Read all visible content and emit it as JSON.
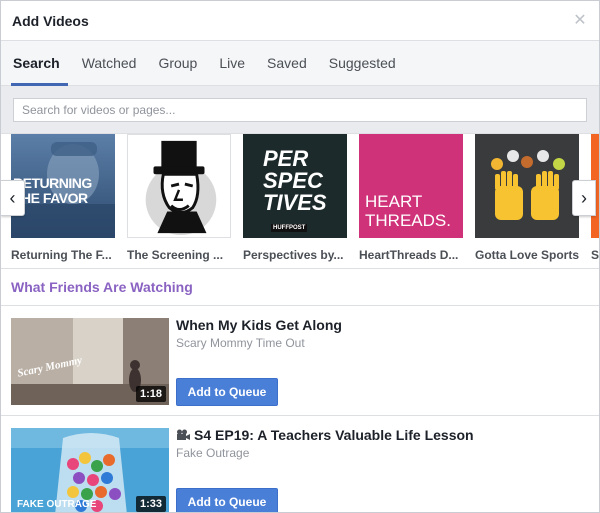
{
  "dialog": {
    "title": "Add Videos",
    "close_icon": "close-icon"
  },
  "tabs": [
    {
      "label": "Search",
      "active": true
    },
    {
      "label": "Watched",
      "active": false
    },
    {
      "label": "Group",
      "active": false
    },
    {
      "label": "Live",
      "active": false
    },
    {
      "label": "Saved",
      "active": false
    },
    {
      "label": "Suggested",
      "active": false
    }
  ],
  "search": {
    "placeholder": "Search for videos or pages...",
    "value": ""
  },
  "pages": [
    {
      "name": "Returning The F...",
      "thumb_text": "RETURNING THE FAVOR"
    },
    {
      "name": "The Screening ...",
      "thumb_text": ""
    },
    {
      "name": "Perspectives by...",
      "thumb_text": "PER SPEC TIVES",
      "thumb_subtext": "HUFFPOST"
    },
    {
      "name": "HeartThreads D...",
      "thumb_text": "HEART THREADS."
    },
    {
      "name": "Gotta Love Sports",
      "thumb_text": ""
    }
  ],
  "carousel": {
    "left_icon": "chevron-left-icon",
    "right_icon": "chevron-right-icon"
  },
  "section": {
    "title": "What Friends Are Watching"
  },
  "videos": [
    {
      "title": "When My Kids Get Along",
      "source": "Scary Mommy Time Out",
      "duration": "1:18",
      "button": "Add to Queue",
      "watermark": "Scary Mommy"
    },
    {
      "title": "S4 EP19: A Teachers Valuable Life Lesson",
      "source": "Fake Outrage",
      "duration": "1:33",
      "button": "Add to Queue",
      "watermark": "FAKE OUTRAGE",
      "title_icon": "film-camera-icon"
    }
  ],
  "colors": {
    "accent": "#4267b2",
    "button": "#4a7fd8",
    "section_title": "#8a63c2",
    "heartthreads_bg": "#d0327a",
    "perspectives_bg": "#1c2a2b",
    "sports_bg": "#3a3b3c"
  }
}
